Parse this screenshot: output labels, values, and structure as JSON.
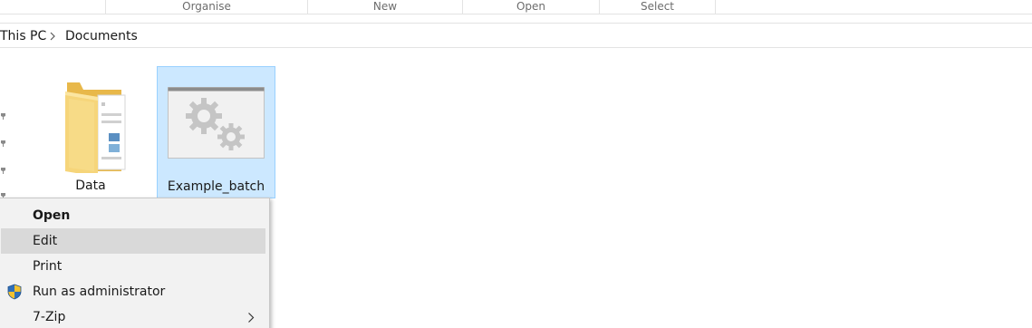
{
  "ribbon": {
    "groups": [
      "Organise",
      "New",
      "Open",
      "Select"
    ]
  },
  "address_bar": {
    "crumbs": [
      "This PC",
      "Documents"
    ]
  },
  "files": [
    {
      "name": "Data",
      "icon": "folder-icon",
      "selected": false
    },
    {
      "name": "Example_batch",
      "icon": "batch-file-gears-icon",
      "selected": true
    }
  ],
  "context_menu": {
    "items": [
      {
        "label": "Open",
        "default": true
      },
      {
        "label": "Edit",
        "highlighted": true
      },
      {
        "label": "Print"
      },
      {
        "label": "Run as administrator",
        "icon": "uac-shield-icon"
      },
      {
        "label": "7-Zip",
        "submenu": true
      }
    ]
  },
  "colors": {
    "selection_bg": "#cce8ff",
    "selection_border": "#99d1ff",
    "menu_bg": "#f2f2f2",
    "menu_hover": "#d9d9d9"
  }
}
